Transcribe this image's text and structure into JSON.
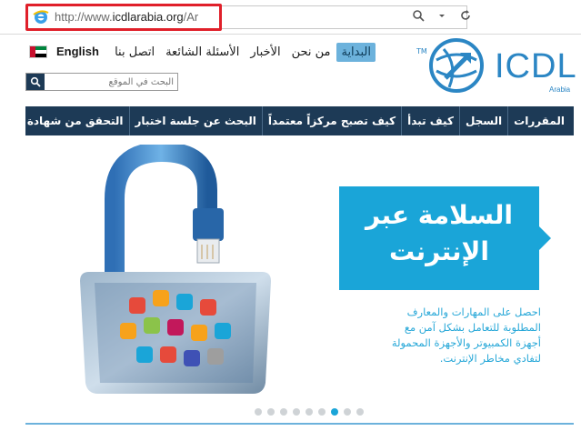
{
  "browser": {
    "url_prefix": "http://www.",
    "url_domain": "icdlarabia.org",
    "url_suffix": "/Ar",
    "tools": [
      "search-icon",
      "dropdown-icon",
      "refresh-icon"
    ]
  },
  "header": {
    "language_link": "English",
    "top_nav": [
      {
        "label": "البداية",
        "active": true
      },
      {
        "label": "من نحن",
        "active": false
      },
      {
        "label": "الأخبار",
        "active": false
      },
      {
        "label": "الأسئلة الشائعة",
        "active": false
      },
      {
        "label": "اتصل بنا",
        "active": false
      }
    ],
    "search_placeholder": "البحث في الموقع",
    "logo_text": "ICDL",
    "logo_sub": "Arabia",
    "logo_tm": "TM"
  },
  "main_nav": [
    "المقررات",
    "السجل",
    "كيف تبدأ",
    "كيف تصبح مركزاً معتمداً",
    "البحث عن جلسة اختبار",
    "التحقق من شهادة"
  ],
  "hero": {
    "title_line1": "السلامة عبر",
    "title_line2": "الإنترنت",
    "description": "احصل على المهارات والمعارف المطلوبة للتعامل بشكل آمن مع أجهزة الكمبيوتر والأجهزة المحمولة لتفادي مخاطر الإنترنت.",
    "slides_total": 9,
    "active_slide": 7
  },
  "colors": {
    "nav_bg": "#1d3a56",
    "accent": "#1aa5d8",
    "highlight": "#e0202a"
  }
}
